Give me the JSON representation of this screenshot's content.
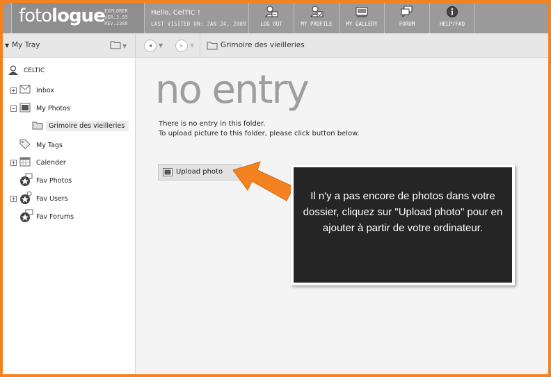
{
  "header": {
    "logo_light": "foto",
    "logo_bold": "logue",
    "logo_edition": "EXPLORER",
    "logo_version": "VER.3.05",
    "logo_revision": "REV.2388",
    "greeting": "Hello, CelTIC !",
    "last_visited": "LAST VISITED ON: JAN 24, 2009",
    "nav": [
      {
        "label": "LOG OUT",
        "icon": "logout-icon"
      },
      {
        "label": "MY PROFILE",
        "icon": "profile-icon"
      },
      {
        "label": "MY GALLERY",
        "icon": "gallery-icon"
      },
      {
        "label": "FORUM",
        "icon": "forum-icon"
      },
      {
        "label": "HELP/FAQ",
        "icon": "info-icon"
      }
    ]
  },
  "toolbar": {
    "tray_label": "My Tray",
    "breadcrumb": "Grimoire des vieilleries"
  },
  "sidebar": {
    "user": "CELTIC",
    "items": [
      {
        "label": "Inbox",
        "icon": "inbox-icon",
        "expander": "+"
      },
      {
        "label": "My Photos",
        "icon": "photos-icon",
        "expander": "−"
      },
      {
        "label": "Grimoire des vieilleries",
        "icon": "folder-icon",
        "selected": true
      },
      {
        "label": "My Tags",
        "icon": "tag-icon"
      },
      {
        "label": "Calender",
        "icon": "calendar-icon",
        "expander": "+"
      },
      {
        "label": "Fav Photos",
        "icon": "fav-photos-icon"
      },
      {
        "label": "Fav Users",
        "icon": "fav-users-icon",
        "expander": "+"
      },
      {
        "label": "Fav Forums",
        "icon": "fav-forums-icon"
      }
    ]
  },
  "main": {
    "heading": "no entry",
    "message_line1": "There is no entry in this folder.",
    "message_line2": "To upload picture to this folder, please click button below.",
    "upload_label": "Upload photo",
    "callout": "Il n'y a pas encore de photos dans votre dossier, cliquez sur \"Upload photo\" pour en ajouter à partir de votre ordinateur."
  },
  "colors": {
    "frame": "#f58220",
    "header": "#9a9a9a",
    "callout_bg": "#252525",
    "arrow": "#f58220"
  }
}
